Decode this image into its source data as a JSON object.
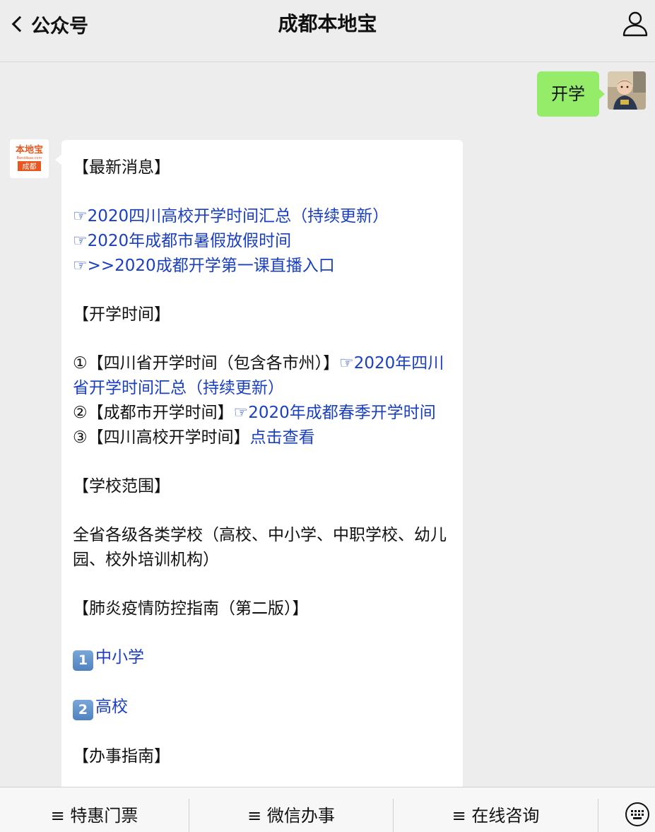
{
  "header": {
    "back_label": "公众号",
    "title": "成都本地宝"
  },
  "user_message": {
    "text": "开学"
  },
  "bot_logo": {
    "line1": "本地宝",
    "line2": "Bendibao.com",
    "line3": "成都"
  },
  "bot_message": {
    "section_latest": "【最新消息】",
    "latest_links": [
      "☞2020四川高校开学时间汇总（持续更新）",
      "☞2020年成都市暑假放假时间",
      "☞>>2020成都开学第一课直播入口"
    ],
    "section_time": "【开学时间】",
    "item1_prefix": "①【四川省开学时间（包含各市州）】",
    "item1_link": "☞2020年四川省开学时间汇总（持续更新）",
    "item2_prefix": "②【成都市开学时间】",
    "item2_link": "☞2020年成都春季开学时间",
    "item3_prefix": "③【四川高校开学时间】",
    "item3_link": "点击查看",
    "section_scope": "【学校范围】",
    "scope_text": "全省各级各类学校（高校、中小学、中职学校、幼儿园、校外培训机构）",
    "section_guide": "【肺炎疫情防控指南（第二版）】",
    "guide_1_num": "1",
    "guide_1_label": "中小学",
    "guide_2_num": "2",
    "guide_2_label": "高校",
    "section_affairs": "【办事指南】"
  },
  "bottom_menu": {
    "item1": "≡ 特惠门票",
    "item2": "≡ 微信办事",
    "item3": "≡ 在线咨询"
  },
  "colors": {
    "link": "#1a3fbf",
    "user_bubble": "#95ec69",
    "background": "#ededed",
    "logo_orange": "#e8571f"
  }
}
